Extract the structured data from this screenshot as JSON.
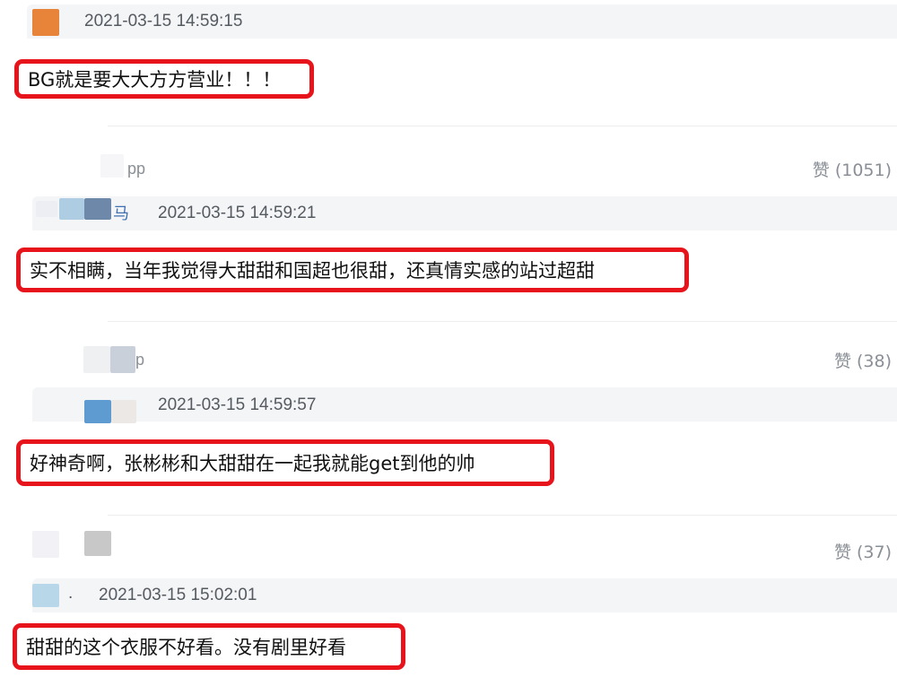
{
  "comments": [
    {
      "timestamp": "2021-03-15 14:59:15",
      "text": "BG就是要大大方方营业！！！",
      "name_fragment": "",
      "avatar_color": "#e8833a"
    },
    {
      "timestamp": "2021-03-15 14:59:21",
      "text": "实不相瞒，当年我觉得大甜甜和国超也很甜，还真情实感的站过超甜",
      "name_fragment": "马",
      "likes": "赞 (1051)",
      "reply_fragment": "pp"
    },
    {
      "timestamp": "2021-03-15 14:59:57",
      "text": "好神奇啊，张彬彬和大甜甜在一起我就能get到他的帅",
      "name_fragment": "",
      "likes": "赞 (38)",
      "reply_fragment": "p"
    },
    {
      "timestamp": "2021-03-15 15:02:01",
      "text": "甜甜的这个衣服不好看。没有剧里好看",
      "name_fragment": ".",
      "likes": "赞 (37)"
    }
  ],
  "colors": {
    "highlight_border": "#e8141c",
    "header_band": "#f4f5f7",
    "timestamp": "#555a60",
    "likes": "#8a8f96"
  }
}
